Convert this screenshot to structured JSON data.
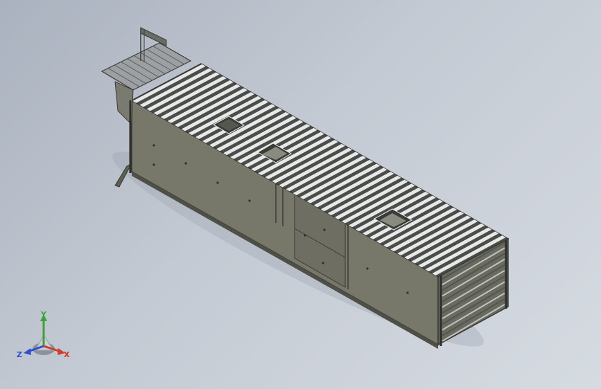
{
  "viewport": {
    "background_top": "#aab2bf",
    "background_bottom": "#d6dbe2"
  },
  "model": {
    "panel_color": "#77786a",
    "panel_dark": "#5d5e53",
    "slat_light": "#e6e8ea",
    "slat_dark": "#4b4d48",
    "edge_color": "#3a3b36",
    "roof_slat_count": 44,
    "end_rib_count": 12,
    "roof_openings": 3
  },
  "triad": {
    "x_label": "X",
    "y_label": "Y",
    "z_label": "Z",
    "x_color": "#d23a2a",
    "y_color": "#3aa33a",
    "z_color": "#2f4fd0"
  }
}
